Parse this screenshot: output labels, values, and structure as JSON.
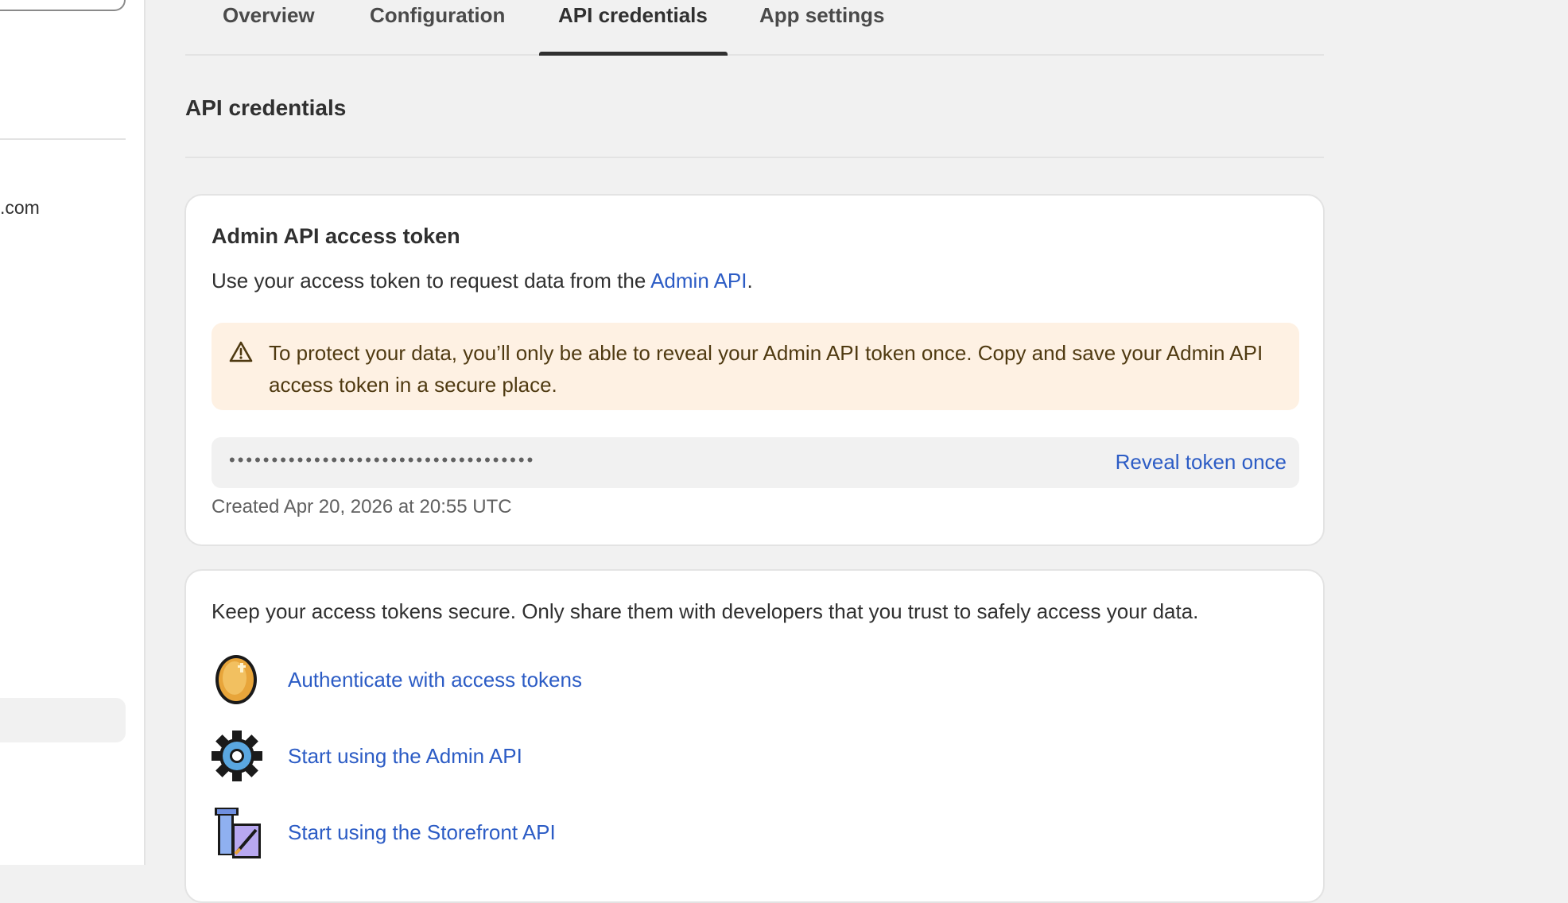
{
  "sidebar": {
    "domain_fragment": ".com"
  },
  "tabs": [
    {
      "label": "Overview",
      "active": false
    },
    {
      "label": "Configuration",
      "active": false
    },
    {
      "label": "API credentials",
      "active": true
    },
    {
      "label": "App settings",
      "active": false
    }
  ],
  "page": {
    "title": "API credentials"
  },
  "token_card": {
    "heading": "Admin API access token",
    "desc_prefix": "Use your access token to request data from the ",
    "desc_link": "Admin API",
    "desc_suffix": ".",
    "warning_text": "To protect your data, you’ll only be able to reveal your Admin API token once. Copy and save your Admin API access token in a secure place.",
    "token_masked": "••••••••••••••••••••••••••••••••••••",
    "reveal_label": "Reveal token once",
    "created": "Created Apr 20, 2026 at 20:55 UTC"
  },
  "resources_card": {
    "desc": "Keep your access tokens secure. Only share them with developers that you trust to safely access your data.",
    "items": [
      {
        "label": "Authenticate with access tokens",
        "icon": "coin-icon"
      },
      {
        "label": "Start using the Admin API",
        "icon": "gear-icon"
      },
      {
        "label": "Start using the Storefront API",
        "icon": "scroll-icon"
      }
    ]
  },
  "colors": {
    "link": "#2c5cc5",
    "warning_bg": "#fef1e3",
    "page_bg": "#f1f1f1"
  }
}
